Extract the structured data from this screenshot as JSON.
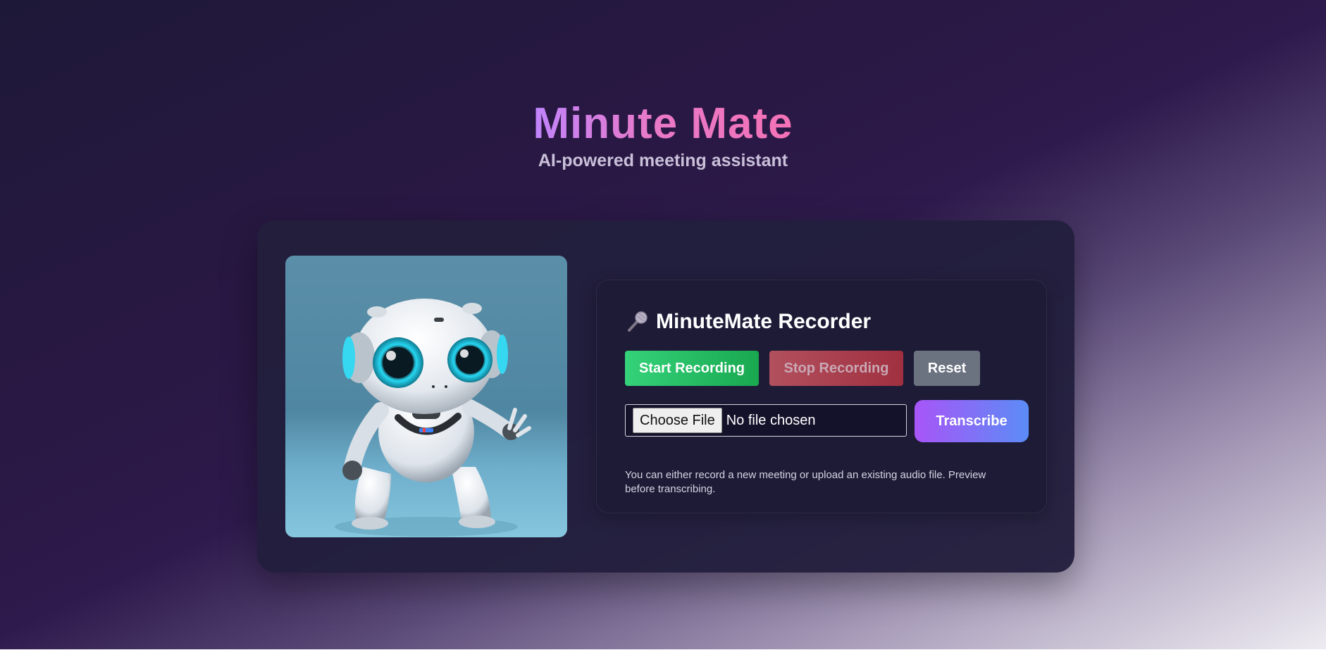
{
  "app": {
    "title": "Minute Mate",
    "subtitle": "AI-powered meeting assistant"
  },
  "recorder": {
    "icon": "microphone-icon",
    "title": "MinuteMate Recorder",
    "buttons": {
      "start": "Start Recording",
      "stop": "Stop Recording",
      "reset": "Reset",
      "transcribe": "Transcribe"
    },
    "file_input": {
      "button_label": "Choose File",
      "status": "No file chosen"
    },
    "helper_text": "You can either record a new meeting or upload an existing audio file. Preview before transcribing."
  },
  "image": {
    "subject": "robot-illustration"
  },
  "colors": {
    "start_button": "#22c55e",
    "stop_button": "#b23a4a",
    "reset_button": "#6b7280",
    "transcribe_gradient_start": "#a855f7",
    "transcribe_gradient_end": "#3b82f6",
    "title_gradient_start": "#c084fc",
    "title_gradient_end": "#f472b6"
  }
}
